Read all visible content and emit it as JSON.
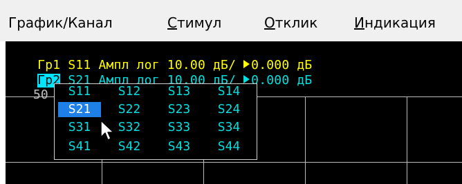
{
  "menubar": {
    "items": [
      {
        "id": "graph",
        "label": "График/Канал"
      },
      {
        "id": "stimulus",
        "u": "С",
        "rest": "тимул"
      },
      {
        "id": "response",
        "u": "О",
        "rest": "тклик"
      },
      {
        "id": "display",
        "u": "И",
        "rest": "ндикация"
      }
    ]
  },
  "traces": [
    {
      "tag": "Гр1",
      "text": " S11 Ампл лог 10.00 дБ/ ",
      "ref": "0.000 дБ",
      "color": "#ffff00"
    },
    {
      "tag": "Гр2",
      "text": " S21 Ампл лог 10.00 дБ/ ",
      "ref": "0.000 дБ",
      "color": "#00e0e0"
    }
  ],
  "scale_label": "50",
  "popup": {
    "selected": "S21",
    "rows": [
      [
        "S11",
        "S12",
        "S13",
        "S14"
      ],
      [
        "S21",
        "S22",
        "S23",
        "S24"
      ],
      [
        "S31",
        "S32",
        "S33",
        "S34"
      ],
      [
        "S41",
        "S42",
        "S43",
        "S44"
      ]
    ]
  },
  "colors": {
    "menubar_bg": "#f0f0f0",
    "plot_bg": "#000000",
    "trace1": "#ffff00",
    "trace2": "#00e0e0",
    "selection": "#1e7fe6"
  }
}
